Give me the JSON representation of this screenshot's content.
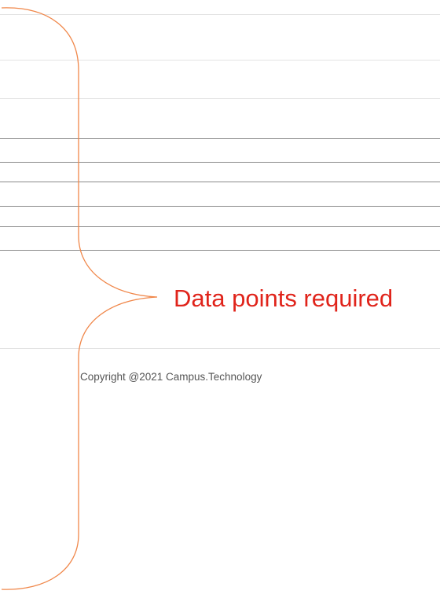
{
  "annotation": {
    "callout_text": "Data points required",
    "callout_color": "#e0241b",
    "brace_color": "#f0874a"
  },
  "footer": {
    "copyright": "Copyright @2021 Campus.Technology"
  },
  "colors": {
    "background": "#ffffff",
    "light_rule": "#e3e3e3",
    "dark_rule": "#8a8a8a",
    "footer_text": "#555555"
  }
}
